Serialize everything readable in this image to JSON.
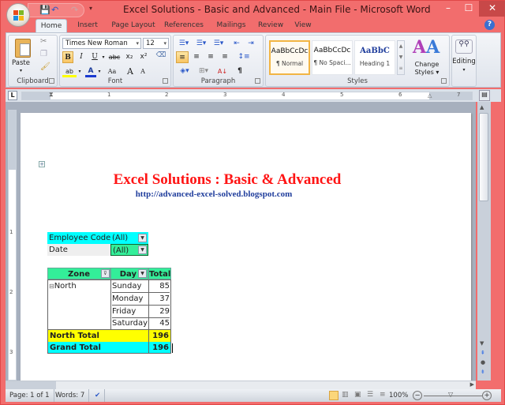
{
  "window": {
    "title": "Excel Solutions - Basic and Advanced - Main File - Microsoft Word",
    "minimize": "–",
    "maximize": "☐",
    "close": "✕"
  },
  "quick_access": {
    "save": "💾",
    "undo": "↶",
    "redo": "↷",
    "more": "▾"
  },
  "tabs": [
    "Home",
    "Insert",
    "Page Layout",
    "References",
    "Mailings",
    "Review",
    "View"
  ],
  "active_tab": "Home",
  "ribbon": {
    "clipboard": {
      "label": "Clipboard",
      "paste": "Paste"
    },
    "font": {
      "label": "Font",
      "font_name": "Times New Roman",
      "font_size": "12",
      "bold": "B",
      "italic": "I",
      "underline": "U",
      "strikethrough": "abc",
      "subscript": "x₂",
      "superscript": "x²",
      "change_case": "Aa",
      "grow": "A",
      "shrink": "A"
    },
    "paragraph": {
      "label": "Paragraph",
      "show_marks": "¶"
    },
    "styles": {
      "label": "Styles",
      "items": [
        {
          "preview": "AaBbCcDc",
          "name": "¶ Normal"
        },
        {
          "preview": "AaBbCcDc",
          "name": "¶ No Spaci..."
        },
        {
          "preview": "AaBbC",
          "name": "Heading 1"
        }
      ],
      "change_styles": "Change Styles ▾"
    },
    "editing": {
      "label": "Editing",
      "caret": "▾"
    }
  },
  "ruler": {
    "tab_selector": "L",
    "numbers": [
      "1",
      "2",
      "3",
      "4",
      "5",
      "6",
      "7"
    ],
    "vnumbers": [
      "1",
      "2",
      "3"
    ]
  },
  "document": {
    "title": "Excel Solutions : Basic & Advanced",
    "url": "http://advanced-excel-solved.blogspot.com",
    "filters": [
      {
        "label": "Employee Code",
        "value": "(All)"
      },
      {
        "label": "Date",
        "value": "(All)"
      }
    ],
    "pivot": {
      "headers": {
        "zone": "Zone",
        "day": "Day",
        "total": "Total"
      },
      "zone": "North",
      "rows": [
        {
          "day": "Sunday",
          "total": "85"
        },
        {
          "day": "Monday",
          "total": "37"
        },
        {
          "day": "Friday",
          "total": "29"
        },
        {
          "day": "Saturday",
          "total": "45"
        }
      ],
      "north_total_label": "North Total",
      "north_total": "196",
      "grand_total_label": "Grand Total",
      "grand_total": "196"
    },
    "colors": {
      "cyan": "#00ffff",
      "green": "#33ee99",
      "yellow": "#ffff00",
      "title_red": "#ff1414",
      "url_blue": "#1f3d9c"
    }
  },
  "status_bar": {
    "page": "Page: 1 of 1",
    "words": "Words: 7",
    "zoom": "100%"
  }
}
